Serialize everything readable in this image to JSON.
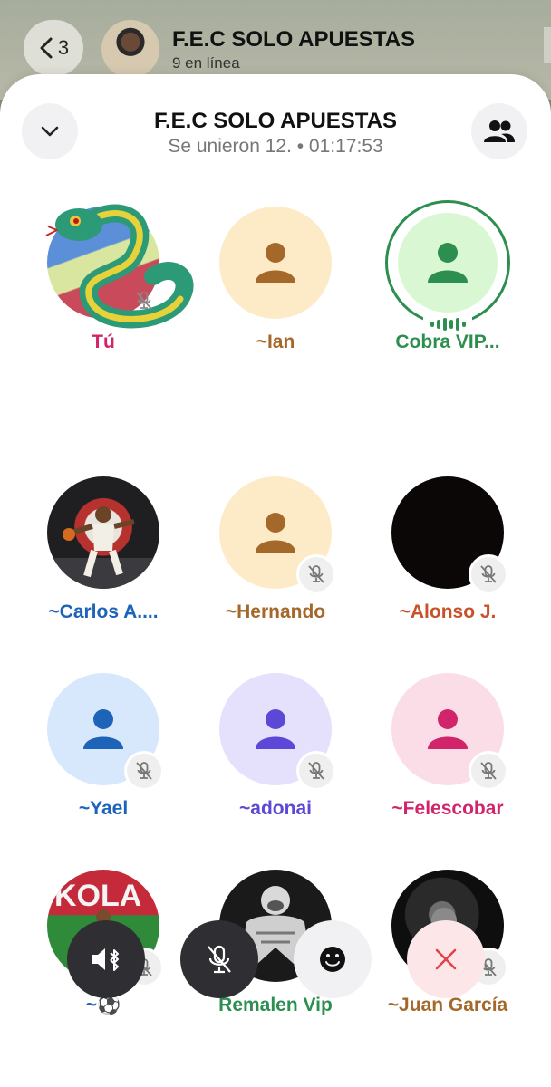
{
  "background": {
    "back_count": "3",
    "chat_title": "F.E.C SOLO APUESTAS",
    "chat_subtitle": "9 en línea"
  },
  "sheet": {
    "title": "F.E.C SOLO APUESTAS",
    "subtitle": "Se unieron 12. • 01:17:53"
  },
  "participants": [
    {
      "name": "Tú",
      "name_color": "#d2246a",
      "avatar": "snake-sticker",
      "muted": true
    },
    {
      "name": "~Ian",
      "name_color": "#a4692a",
      "avatar": "placeholder",
      "muted": false
    },
    {
      "name": "Cobra VIP...",
      "name_color": "#2d8f4f",
      "avatar": "placeholder",
      "speaking": true,
      "muted": false
    },
    {
      "name": "~Carlos A....",
      "name_color": "#1d63b8",
      "avatar": "basketball-photo",
      "muted": false
    },
    {
      "name": "~Hernando",
      "name_color": "#a4692a",
      "avatar": "placeholder",
      "muted": true
    },
    {
      "name": "~Alonso J.",
      "name_color": "#c8512a",
      "avatar": "black-photo",
      "muted": true
    },
    {
      "name": "~Yael",
      "name_color": "#1d63b8",
      "avatar": "placeholder",
      "muted": true
    },
    {
      "name": "~adonai",
      "name_color": "#5b48d6",
      "avatar": "placeholder",
      "muted": true
    },
    {
      "name": "~Felescobar",
      "name_color": "#d2246a",
      "avatar": "placeholder",
      "muted": true
    },
    {
      "name": "~⚽",
      "name_color": "#1d63b8",
      "avatar": "soccer-photo",
      "muted": true
    },
    {
      "name": "Remalen Vip",
      "name_color": "#2d8f4f",
      "avatar": "gorilla-photo",
      "muted": true
    },
    {
      "name": "~Juan García",
      "name_color": "#a4692a",
      "avatar": "dark-photo",
      "muted": true
    }
  ],
  "controls": [
    {
      "name": "speaker-bluetooth-button",
      "icon": "speaker-bluetooth-icon"
    },
    {
      "name": "mute-button",
      "icon": "mic-off-icon"
    },
    {
      "name": "reactions-button",
      "icon": "smiley-icon"
    },
    {
      "name": "leave-call-button",
      "icon": "close-icon"
    }
  ],
  "colors": {
    "ian_bg": "#fdebc8",
    "ian_fg": "#a4692a",
    "cobra_bg": "#d9f7d2",
    "cobra_fg": "#2d8f4f",
    "yael_bg": "#d7e8fc",
    "yael_fg": "#1d63b8",
    "adonai_bg": "#e5e0fb",
    "adonai_fg": "#5b48d6",
    "fel_bg": "#fbdde8",
    "fel_fg": "#d2246a",
    "leave_bg": "#fde6e8",
    "leave_fg": "#e0414d"
  }
}
